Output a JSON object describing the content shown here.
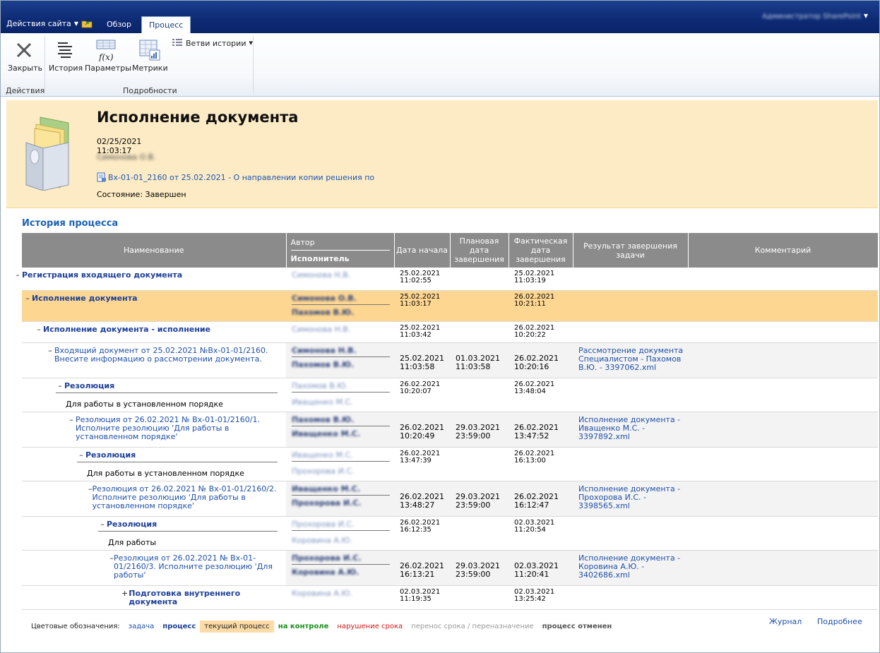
{
  "topbar": {
    "site_actions": "Действия сайта",
    "tabs": [
      "Обзор",
      "Процесс"
    ],
    "user": "Администратор SharePoint"
  },
  "ribbon": {
    "close": "Закрыть",
    "history": "История",
    "params": "Параметры",
    "metrics": "Метрики",
    "branches": "Ветви истории",
    "group_actions": "Действия",
    "group_details": "Подробности"
  },
  "doc": {
    "title": "Исполнение документа",
    "date": "02/25/2021 11:03:17",
    "author": "Симонова О.В.",
    "link": "Вх-01-01_2160 от 25.02.2021 - О направлении копии решения по",
    "state": "Состояние: Завершен"
  },
  "history_title": "История процесса",
  "table": {
    "headers": {
      "name": "Наименование",
      "author": "Автор",
      "executor": "Исполнитель",
      "start": "Дата начала",
      "planned": "Плановая дата завершения",
      "actual": "Фактическая дата завершения",
      "result": "Результат завершения задачи",
      "comment": "Комментарий"
    },
    "rows": [
      {
        "toggle": "–",
        "name": "Регистрация входящего документа",
        "author": "Симонова Н.В.",
        "executor": "",
        "start": "25.02.2021 11:02:55",
        "planned": "",
        "actual": "25.02.2021 11:03:19",
        "result": "",
        "sub": ""
      },
      {
        "toggle": "–",
        "name": "Исполнение документа",
        "author": "Симонова О.В.",
        "executor": "Пахомов В.Ю.",
        "start": "25.02.2021 11:03:17",
        "planned": "",
        "actual": "26.02.2021 10:21:11",
        "result": "",
        "sub": ""
      },
      {
        "toggle": "–",
        "name": "Исполнение документа - исполнение",
        "author": "Симонова Н.В.",
        "executor": "",
        "start": "25.02.2021 11:03:42",
        "planned": "",
        "actual": "26.02.2021 10:20:22",
        "result": "",
        "sub": ""
      },
      {
        "toggle": "–",
        "name": "Входящий документ от 25.02.2021 №Вх-01-01/2160. Внесите информацию о рассмотрении документа.",
        "author": "Симонова Н.В.",
        "executor": "Пахомов В.Ю.",
        "start": "25.02.2021 11:03:58",
        "planned": "01.03.2021 11:03:58",
        "actual": "26.02.2021 10:20:16",
        "result": "Рассмотрение документа Специалистом - Пахомов В.Ю. - 3397062.xml",
        "sub": ""
      },
      {
        "toggle": "–",
        "name": "Резолюция",
        "author": "Пахомов В.Ю.",
        "executor": "Иващенко М.С.",
        "start": "26.02.2021 10:20:07",
        "planned": "",
        "actual": "26.02.2021 13:48:04",
        "result": "",
        "sub": "Для работы в установленном порядке"
      },
      {
        "toggle": "–",
        "name": "Резолюция от 26.02.2021 № Вх-01-01/2160/1. Исполните резолюцию 'Для работы в установленном порядке'",
        "author": "Пахомов В.Ю.",
        "executor": "Иващенко М.С.",
        "start": "26.02.2021 10:20:49",
        "planned": "29.03.2021 23:59:00",
        "actual": "26.02.2021 13:47:52",
        "result": "Исполнение документа - Иващенко М.С. - 3397892.xml",
        "sub": ""
      },
      {
        "toggle": "–",
        "name": "Резолюция",
        "author": "Иващенко М.С.",
        "executor": "Прохорова И.С.",
        "start": "26.02.2021 13:47:39",
        "planned": "",
        "actual": "26.02.2021 16:13:00",
        "result": "",
        "sub": "Для работы в установленном порядке"
      },
      {
        "toggle": "–",
        "name": "Резолюция от 26.02.2021 № Вх-01-01/2160/2. Исполните резолюцию 'Для работы в установленном порядке'",
        "author": "Иващенко М.С.",
        "executor": "Прохорова И.С.",
        "start": "26.02.2021 13:48:27",
        "planned": "29.03.2021 23:59:00",
        "actual": "26.02.2021 16:12:47",
        "result": "Исполнение документа - Прохорова И.С. - 3398565.xml",
        "sub": ""
      },
      {
        "toggle": "–",
        "name": "Резолюция",
        "author": "Прохорова И.С.",
        "executor": "Коровина А.Ю.",
        "start": "26.02.2021 16:12:35",
        "planned": "",
        "actual": "02.03.2021 11:20:54",
        "result": "",
        "sub": "Для работы"
      },
      {
        "toggle": "–",
        "name": "Резолюция от 26.02.2021 № Вх-01-01/2160/3. Исполните резолюцию 'Для работы'",
        "author": "Прохорова И.С.",
        "executor": "Коровина А.Ю.",
        "start": "26.02.2021 16:13:21",
        "planned": "29.03.2021 23:59:00",
        "actual": "02.03.2021 11:20:41",
        "result": "Исполнение документа - Коровина А.Ю. - 3402686.xml",
        "sub": ""
      },
      {
        "toggle": "+",
        "name": "Подготовка внутреннего документа",
        "author": "Коровина А.Ю.",
        "executor": "",
        "start": "02.03.2021 11:19:35",
        "planned": "",
        "actual": "02.03.2021 13:25:42",
        "result": "",
        "sub": ""
      }
    ]
  },
  "legend": {
    "label": "Цветовые обозначения:",
    "task": "задача",
    "process": "процесс",
    "current": "текущий процесс",
    "control": "на контроле",
    "violation": "нарушение срока",
    "transfer": "перенос срока / переназначение",
    "cancelled": "процесс отменен"
  },
  "footer": {
    "journal": "Журнал",
    "more": "Подробнее"
  },
  "colors": {
    "topbar": "#0d2a74",
    "header_bg": "#fdebc5",
    "current_row": "#fdd792",
    "link": "#1f50a8",
    "table_header": "#8b8b8b"
  }
}
